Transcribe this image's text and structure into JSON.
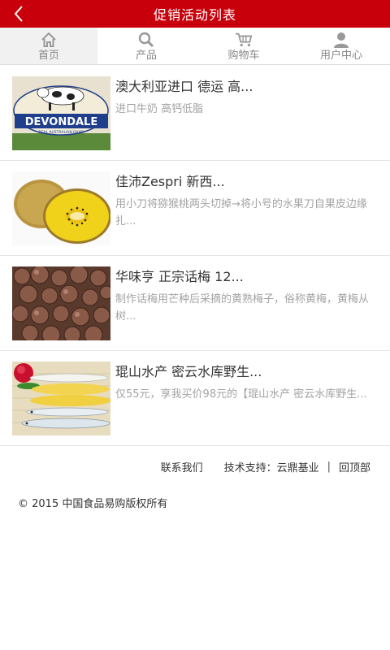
{
  "header": {
    "title": "促销活动列表",
    "back_icon": "chevron-left-icon"
  },
  "nav": [
    {
      "label": "首页",
      "icon": "home-icon",
      "active": true
    },
    {
      "label": "产品",
      "icon": "search-icon",
      "active": false
    },
    {
      "label": "购物车",
      "icon": "cart-icon",
      "active": false
    },
    {
      "label": "用户中心",
      "icon": "user-icon",
      "active": false
    }
  ],
  "items": [
    {
      "title": "澳大利亚进口 德运 高...",
      "desc": "进口牛奶 高钙低脂",
      "image": "devondale-milk",
      "brand_text": "DEVONDALE",
      "brand_sub": "REAL AUSTRALIAN DAIRY"
    },
    {
      "title": "佳沛Zespri 新西...",
      "desc": "用小刀将猕猴桃两头切掉→将小号的水果刀自果皮边缘扎...",
      "image": "golden-kiwi"
    },
    {
      "title": "华味亨 正宗话梅 12...",
      "desc": "制作话梅用芒种后采摘的黄熟梅子，俗称黄梅，黄梅从树...",
      "image": "dried-plums"
    },
    {
      "title": "琨山水产 密云水库野生...",
      "desc": "仅55元，享我买价98元的【琨山水产 密云水库野生...",
      "image": "fish"
    }
  ],
  "footer": {
    "contact": "联系我们",
    "support": "技术支持：云鼎基业",
    "separator": "|",
    "back_to_top": "回顶部",
    "copyright": "© 2015 中国食品易购版权所有"
  },
  "colors": {
    "header_bg": "#c8000b",
    "active_tab_bg": "#f1f1f1"
  }
}
